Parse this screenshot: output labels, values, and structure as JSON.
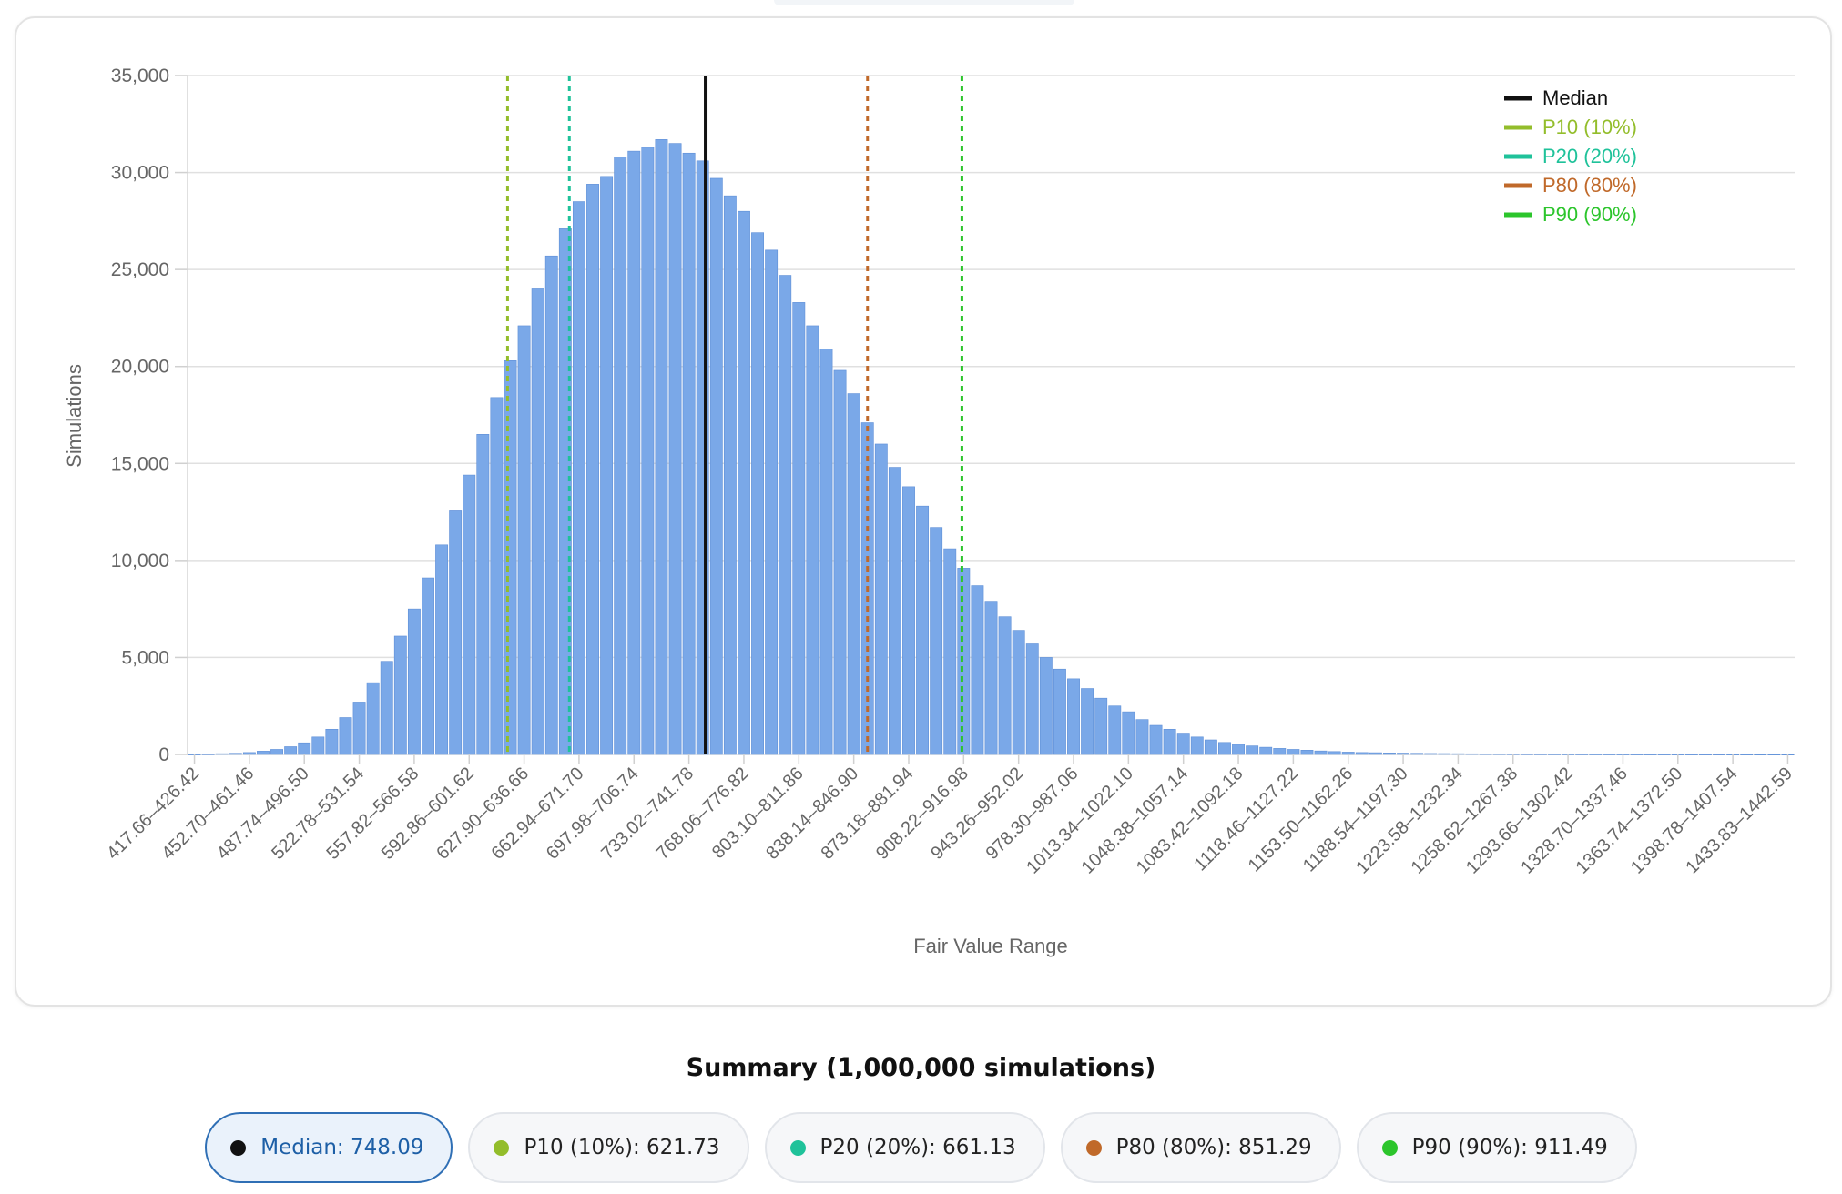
{
  "chart_data": {
    "type": "bar",
    "title": "",
    "xlabel": "Fair Value Range",
    "ylabel": "Simulations",
    "ylim": [
      0,
      35000
    ],
    "yticks": [
      0,
      5000,
      10000,
      15000,
      20000,
      25000,
      30000,
      35000
    ],
    "ytick_labels": [
      "0",
      "5,000",
      "10,000",
      "15,000",
      "20,000",
      "25,000",
      "30,000",
      "35,000"
    ],
    "grid": true,
    "legend_position": "top-right",
    "bin_start": 417.66,
    "bin_width": 8.76,
    "bin_count": 117,
    "category_tick_labels": [
      "417.66–426.42",
      "452.70–461.46",
      "487.74–496.50",
      "522.78–531.54",
      "557.82–566.58",
      "592.86–601.62",
      "627.90–636.66",
      "662.94–671.70",
      "697.98–706.74",
      "733.02–741.78",
      "768.06–776.82",
      "803.10–811.86",
      "838.14–846.90",
      "873.18–881.94",
      "908.22–916.98",
      "943.26–952.02",
      "978.30–987.06",
      "1013.34–1022.10",
      "1048.38–1057.14",
      "1083.42–1092.18",
      "1118.46–1127.22",
      "1153.50–1162.26",
      "1188.54–1197.30",
      "1223.58–1232.34",
      "1258.62–1267.38",
      "1293.66–1302.42",
      "1328.70–1337.46",
      "1363.74–1372.50",
      "1398.78–1407.54",
      "1433.83–1442.59"
    ],
    "values": [
      10,
      20,
      40,
      60,
      100,
      170,
      260,
      400,
      600,
      900,
      1300,
      1900,
      2700,
      3700,
      4800,
      6100,
      7500,
      9100,
      10800,
      12600,
      14400,
      16500,
      18400,
      20300,
      22100,
      24000,
      25700,
      27100,
      28500,
      29400,
      29800,
      30800,
      31100,
      31300,
      31700,
      31500,
      31000,
      30600,
      29700,
      28800,
      28000,
      26900,
      26000,
      24700,
      23300,
      22100,
      20900,
      19800,
      18600,
      17100,
      16000,
      14800,
      13800,
      12800,
      11700,
      10600,
      9600,
      8700,
      7900,
      7100,
      6400,
      5700,
      5000,
      4400,
      3900,
      3400,
      2900,
      2500,
      2200,
      1800,
      1500,
      1300,
      1100,
      900,
      750,
      620,
      520,
      440,
      370,
      310,
      260,
      220,
      180,
      150,
      120,
      100,
      90,
      80,
      70,
      60,
      50,
      45,
      40,
      35,
      30,
      28,
      25,
      22,
      20,
      18,
      16,
      15,
      14,
      13,
      12,
      11,
      10,
      10,
      9,
      9,
      8,
      8,
      7,
      7,
      6,
      6,
      5
    ],
    "markers": [
      {
        "name": "Median",
        "value": 748.09,
        "color": "#111111",
        "style": "solid"
      },
      {
        "name": "P10 (10%)",
        "value": 621.73,
        "color": "#93bd2b",
        "style": "dashed"
      },
      {
        "name": "P20 (20%)",
        "value": 661.13,
        "color": "#1fc29a",
        "style": "dashed"
      },
      {
        "name": "P80 (80%)",
        "value": 851.29,
        "color": "#c0692a",
        "style": "dashed"
      },
      {
        "name": "P90 (90%)",
        "value": 911.49,
        "color": "#2cc52c",
        "style": "dashed"
      }
    ],
    "bar_color": "#7aa8e8"
  },
  "summary": {
    "title": "Summary (1,000,000 simulations)",
    "pills": [
      {
        "label": "Median: 748.09",
        "color": "#111111",
        "active": true
      },
      {
        "label": "P10 (10%): 621.73",
        "color": "#93bd2b",
        "active": false
      },
      {
        "label": "P20 (20%): 661.13",
        "color": "#1fc29a",
        "active": false
      },
      {
        "label": "P80 (80%): 851.29",
        "color": "#c0692a",
        "active": false
      },
      {
        "label": "P90 (90%): 911.49",
        "color": "#2cc52c",
        "active": false
      }
    ]
  }
}
